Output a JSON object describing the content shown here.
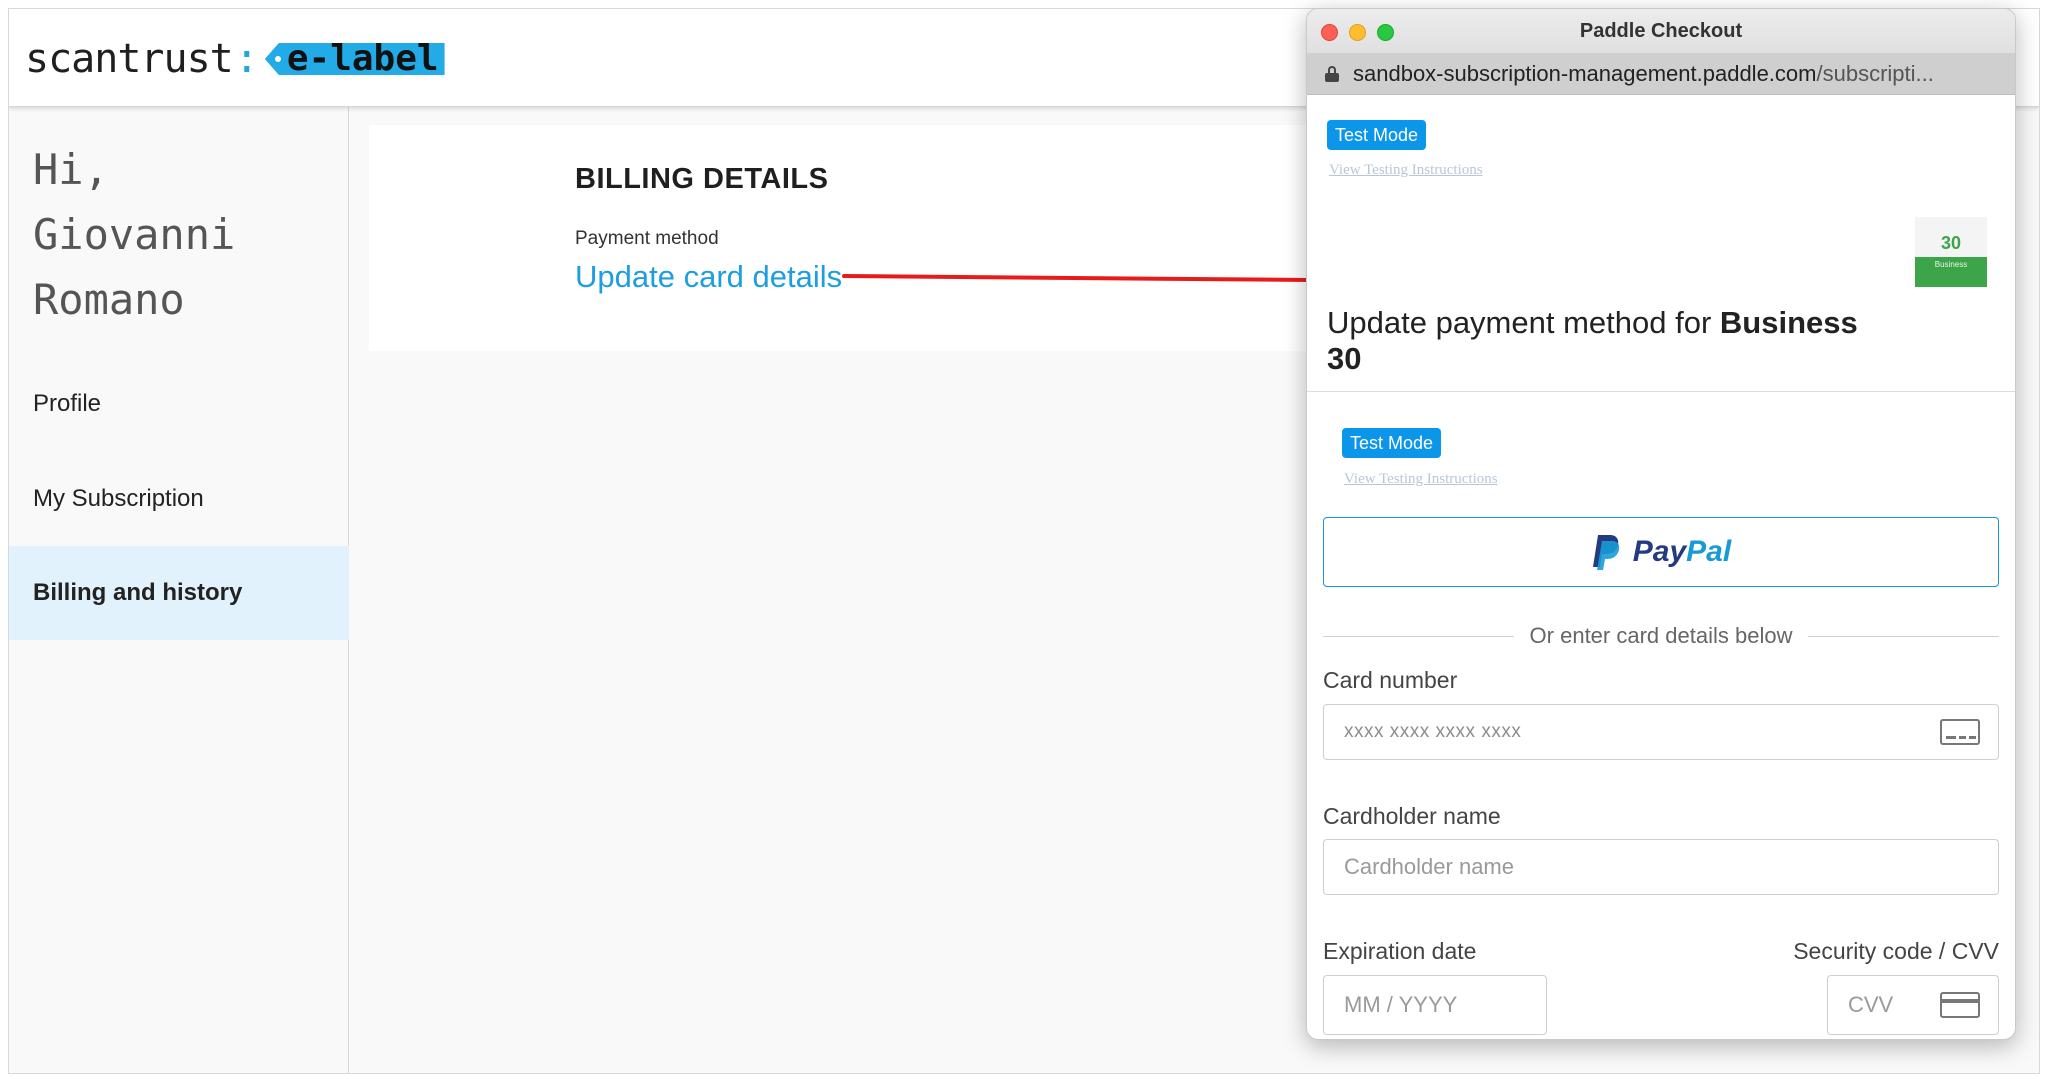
{
  "app": {
    "logo": {
      "word": "scantrust",
      "colon": ":",
      "tag": "e-label"
    },
    "greeting": "Hi, Giovanni Romano",
    "nav": [
      {
        "label": "Profile",
        "active": false
      },
      {
        "label": "My Subscription",
        "active": false
      },
      {
        "label": "Billing and history",
        "active": true
      }
    ],
    "billing": {
      "title": "BILLING DETAILS",
      "payment_method_label": "Payment method",
      "update_link": "Update card details"
    }
  },
  "popup": {
    "window_title": "Paddle Checkout",
    "url_host": "sandbox-subscription-management.paddle.com",
    "url_path": "/subscripti...",
    "test_badge": "Test Mode",
    "testing_link": "View Testing Instructions",
    "product_thumb": {
      "number": "30",
      "label": "Business"
    },
    "heading_prefix": "Update payment method for ",
    "heading_bold": "Business 30",
    "paypal": {
      "pay": "Pay",
      "pal": "Pal"
    },
    "or_text": "Or enter card details below",
    "card_number": {
      "label": "Card number",
      "placeholder": "xxxx xxxx xxxx xxxx"
    },
    "cardholder": {
      "label": "Cardholder name",
      "placeholder": "Cardholder name"
    },
    "expiration": {
      "label": "Expiration date",
      "placeholder": "MM / YYYY"
    },
    "cvv": {
      "label": "Security code / CVV",
      "placeholder": "CVV"
    }
  },
  "colors": {
    "accent_blue": "#1d9ee0",
    "test_badge": "#0b96ea",
    "active_nav_bg": "#e2f2fd",
    "arrow_red": "#e81b1b",
    "thumb_green": "#3ca54a"
  },
  "icons": [
    "lock-icon",
    "paypal-icon",
    "credit-card-icon",
    "arrow-annotation"
  ]
}
